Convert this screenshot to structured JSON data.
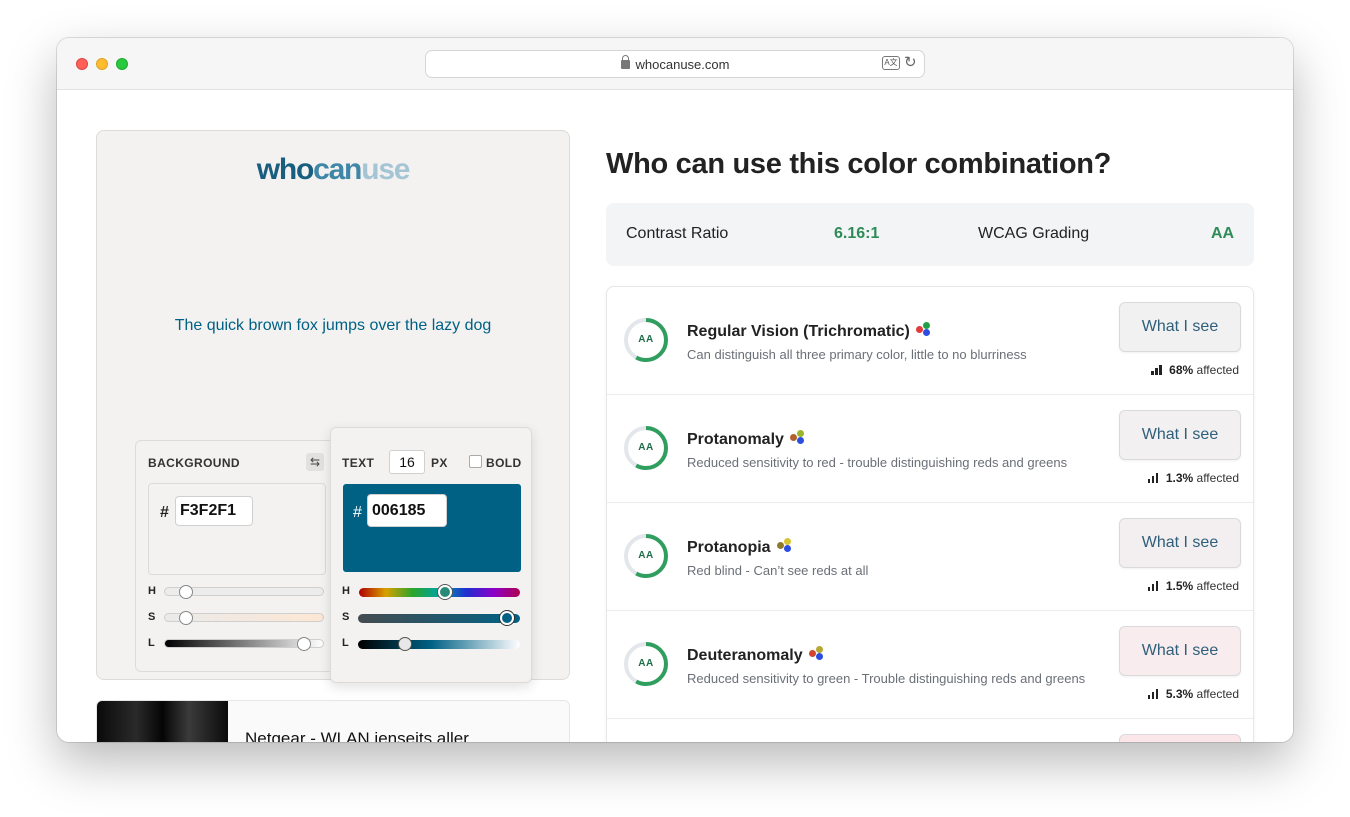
{
  "browser": {
    "url": "whocanuse.com"
  },
  "logo": {
    "part1": "who",
    "part2": "can",
    "part3": "use"
  },
  "preview": {
    "sample_text": "The quick brown fox jumps over the lazy dog"
  },
  "background_panel": {
    "label": "BACKGROUND",
    "hash": "#",
    "hex_value": "F3F2F1",
    "slider_labels": {
      "h": "H",
      "s": "S",
      "l": "L"
    },
    "h_level": 0.1,
    "s_level": 0.1,
    "l_level": 0.92
  },
  "text_panel": {
    "label": "TEXT",
    "size_value": "16",
    "size_unit": "PX",
    "bold_label": "BOLD",
    "hash": "#",
    "hex_value": "006185",
    "slider_labels": {
      "h": "H",
      "s": "S",
      "l": "L"
    },
    "h_level": 0.54,
    "s_level": 0.96,
    "l_level": 0.27
  },
  "ad": {
    "title": "Netgear - WLAN jenseits aller"
  },
  "heading": "Who can use this color combination?",
  "contrast": {
    "ratio_label": "Contrast Ratio",
    "ratio_value": "6.16:1",
    "grading_label": "WCAG Grading",
    "grading_value": "AA"
  },
  "results": [
    {
      "grade": "AA",
      "title": "Regular Vision (Trichromatic)",
      "description": "Can distinguish all three primary color, little to no blurriness",
      "button": "What I see",
      "affected_value": "68%",
      "affected_label": "affected",
      "dots": [
        "#e23b3b",
        "#22a045",
        "#2b4ee0"
      ],
      "button_bg": "#f1f1f1"
    },
    {
      "grade": "AA",
      "title": "Protanomaly",
      "description": "Reduced sensitivity to red - trouble distinguishing reds and greens",
      "button": "What I see",
      "affected_value": "1.3%",
      "affected_label": "affected",
      "dots": [
        "#b0612c",
        "#9ab52a",
        "#2b4ee0"
      ],
      "button_bg": "#f2f0f0"
    },
    {
      "grade": "AA",
      "title": "Protanopia",
      "description": "Red blind - Can’t see reds at all",
      "button": "What I see",
      "affected_value": "1.5%",
      "affected_label": "affected",
      "dots": [
        "#8f7a2a",
        "#d8c431",
        "#2b4ee0"
      ],
      "button_bg": "#f3eff0"
    },
    {
      "grade": "AA",
      "title": "Deuteranomaly",
      "description": "Reduced sensitivity to green - Trouble distinguishing reds and greens",
      "button": "What I see",
      "affected_value": "5.3%",
      "affected_label": "affected",
      "dots": [
        "#d2452f",
        "#b8a730",
        "#2b4ee0"
      ],
      "button_bg": "#f8ecee"
    }
  ]
}
